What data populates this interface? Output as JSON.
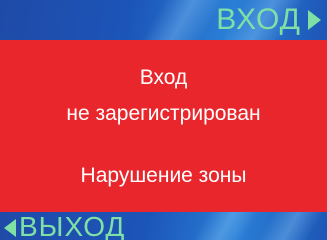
{
  "header": {
    "enter_label": "ВХОД",
    "enter_icon": "triangle-right-icon"
  },
  "message": {
    "line1": "Вход",
    "line2": "не зарегистрирован",
    "line3": "Нарушение зоны"
  },
  "footer": {
    "exit_label": "ВЫХОД",
    "exit_icon": "triangle-left-icon"
  },
  "colors": {
    "panel_red": "#e8262b",
    "bar_blue": "#1c55b8",
    "label_green": "#7fe0a6",
    "text_white": "#ffffff"
  }
}
